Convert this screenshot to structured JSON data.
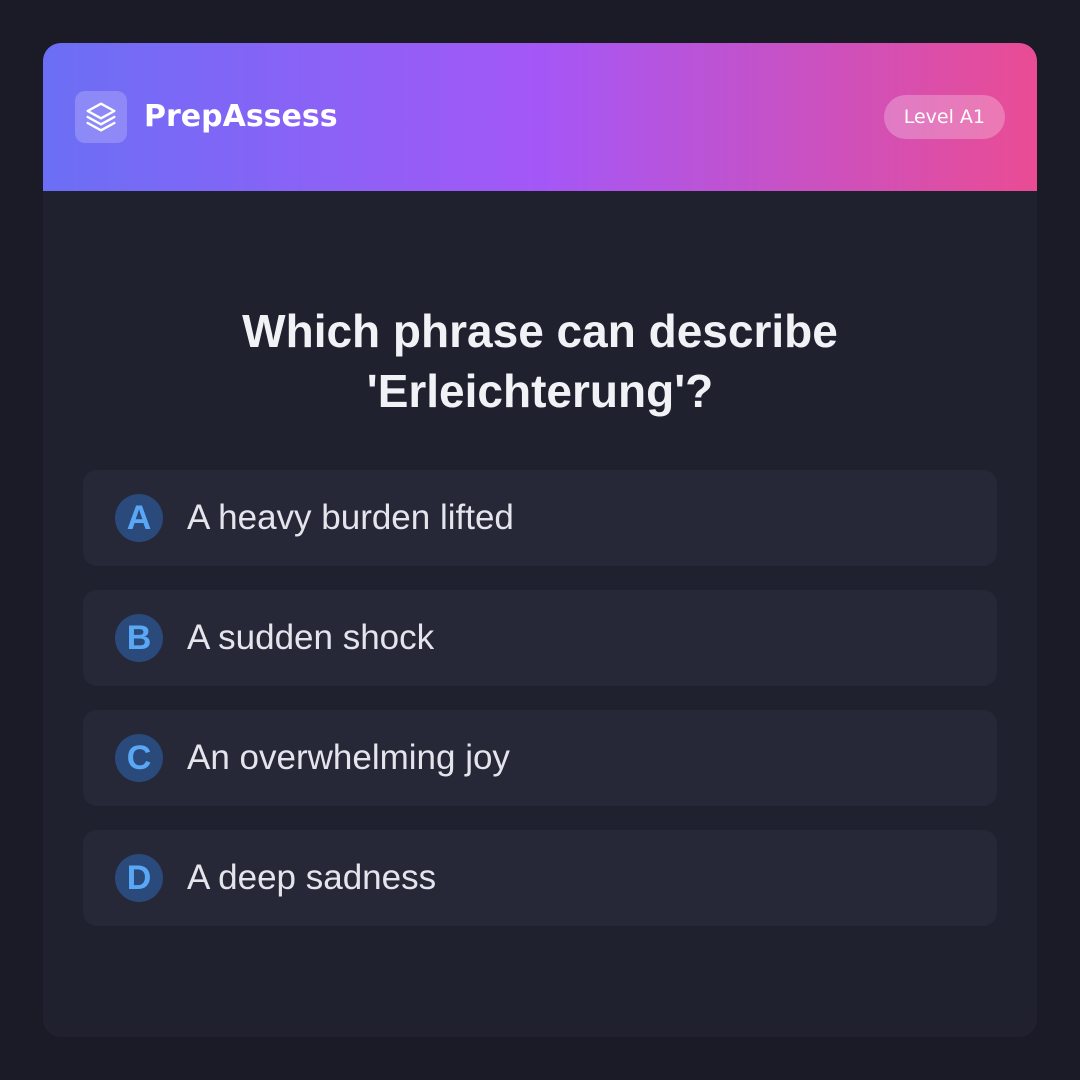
{
  "header": {
    "logo_icon": "layers-icon",
    "brand": "PrepAssess",
    "level": "Level A1"
  },
  "question": "Which phrase can describe 'Erleichterung'?",
  "options": [
    {
      "letter": "A",
      "text": "A heavy burden lifted"
    },
    {
      "letter": "B",
      "text": "A sudden shock"
    },
    {
      "letter": "C",
      "text": "An overwhelming joy"
    },
    {
      "letter": "D",
      "text": "A deep sadness"
    }
  ],
  "colors": {
    "background": "#1a1b26",
    "card": "#1f212e",
    "option_bg": "#262837",
    "gradient_start": "#6b6ff5",
    "gradient_mid": "#a457f7",
    "gradient_end": "#ea4c94",
    "letter_bg": "#2b4a7c",
    "letter_fg": "#5aa8f5"
  }
}
